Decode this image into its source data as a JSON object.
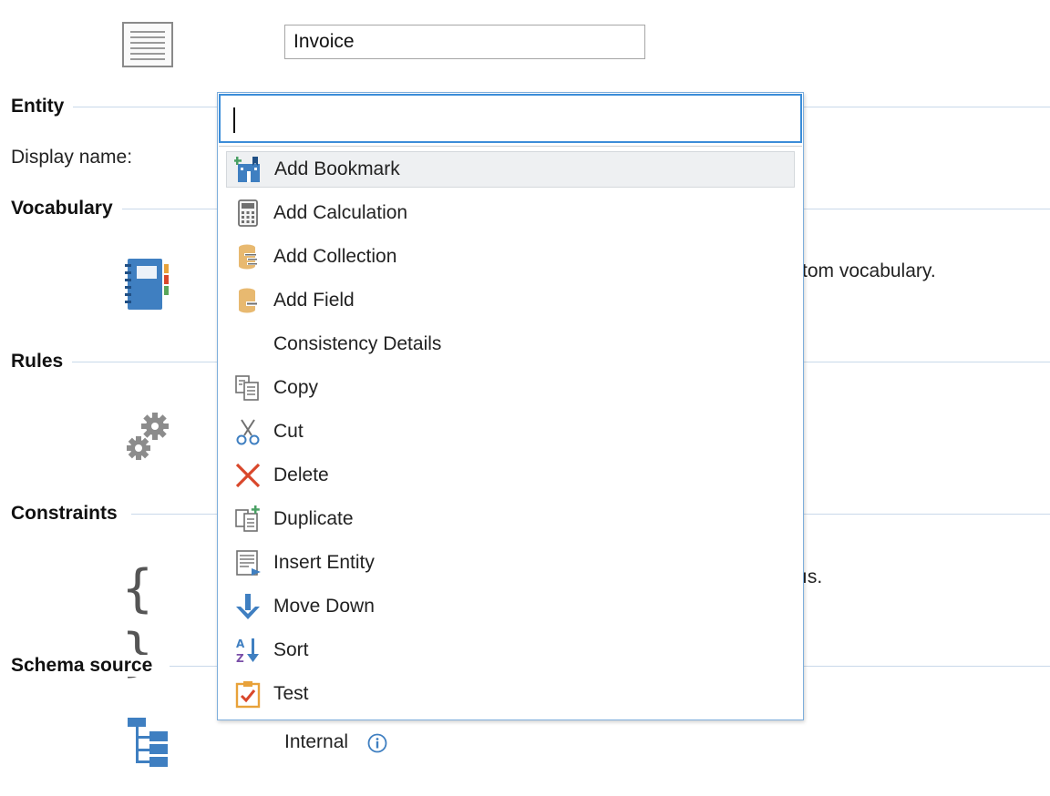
{
  "entity_name_field": {
    "value": "Invoice"
  },
  "sections": {
    "entity": {
      "title": "Entity",
      "display_name_label": "Display name:"
    },
    "vocabulary": {
      "title": "Vocabulary",
      "description_fragment": "tom vocabulary."
    },
    "rules": {
      "title": "Rules"
    },
    "constraints": {
      "title": "Constraints",
      "description_fragment": "ıs."
    },
    "schema_source": {
      "title": "Schema source",
      "value": "Internal"
    }
  },
  "popup": {
    "search_value": "",
    "items": [
      {
        "label": "Add Bookmark",
        "icon": "bookmark-icon",
        "highlighted": true
      },
      {
        "label": "Add Calculation",
        "icon": "calculator-icon"
      },
      {
        "label": "Add Collection",
        "icon": "collection-icon"
      },
      {
        "label": "Add Field",
        "icon": "field-icon"
      },
      {
        "label": "Consistency Details",
        "icon": ""
      },
      {
        "label": "Copy",
        "icon": "copy-icon"
      },
      {
        "label": "Cut",
        "icon": "scissors-icon"
      },
      {
        "label": "Delete",
        "icon": "delete-x-icon"
      },
      {
        "label": "Duplicate",
        "icon": "duplicate-icon"
      },
      {
        "label": "Insert Entity",
        "icon": "insert-entity-icon"
      },
      {
        "label": "Move Down",
        "icon": "arrow-down-icon"
      },
      {
        "label": "Sort",
        "icon": "sort-az-icon"
      },
      {
        "label": "Test",
        "icon": "test-clipboard-icon"
      }
    ]
  },
  "colors": {
    "accent": "#3c8dd8",
    "icon_blue": "#3f7fc1",
    "delete_red": "#d9472b",
    "field_tan": "#e8b970"
  }
}
